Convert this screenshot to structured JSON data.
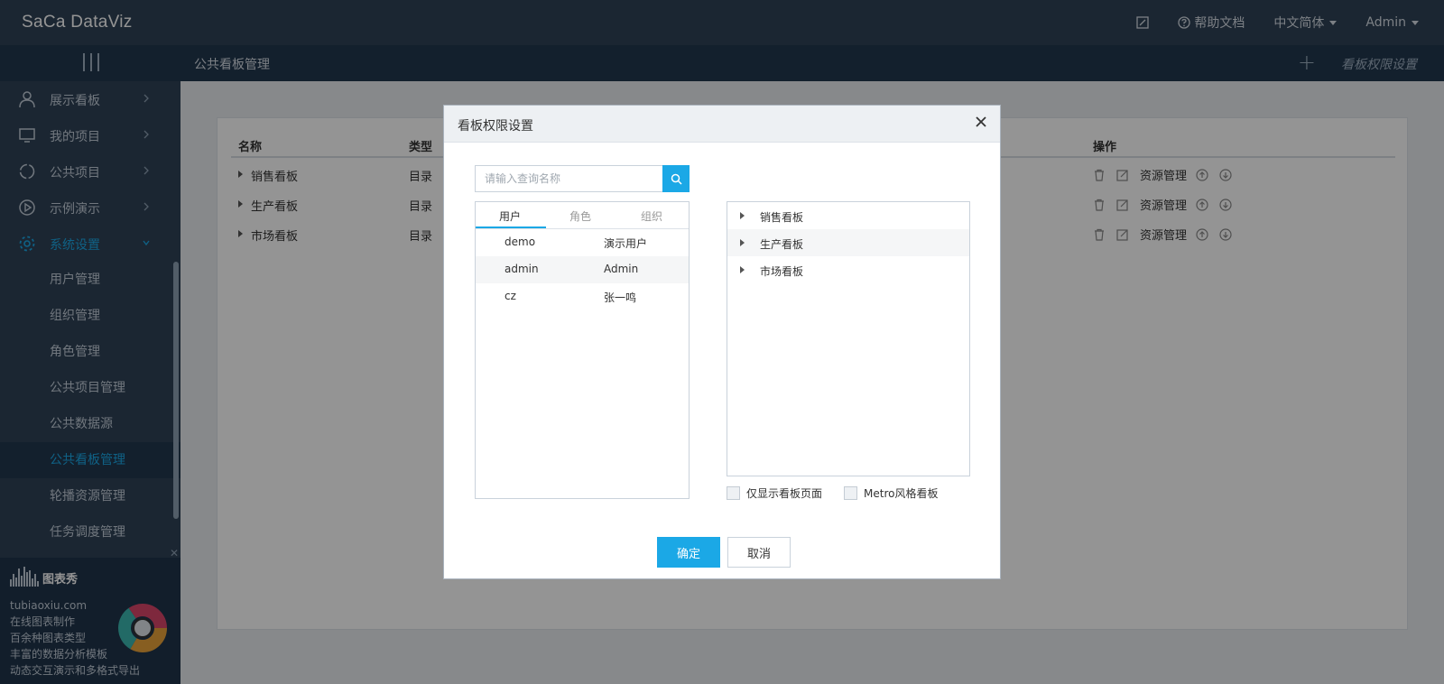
{
  "app": {
    "logo_text": "SaCa DataViz"
  },
  "topbar": {
    "help_label": "帮助文档",
    "language_label": "中文简体",
    "user_label": "Admin"
  },
  "subbar": {
    "title": "公共看板管理",
    "permission_link": "看板权限设置"
  },
  "sidebar": {
    "items": [
      {
        "label": "展示看板",
        "icon": "user-icon"
      },
      {
        "label": "我的项目",
        "icon": "monitor-icon"
      },
      {
        "label": "公共项目",
        "icon": "refresh-icon"
      },
      {
        "label": "示例演示",
        "icon": "play-icon"
      },
      {
        "label": "系统设置",
        "icon": "gear-icon"
      }
    ],
    "subitems": [
      "用户管理",
      "组织管理",
      "角色管理",
      "公共项目管理",
      "公共数据源",
      "公共看板管理",
      "轮播资源管理",
      "任务调度管理"
    ]
  },
  "ad": {
    "brand": "图表秀",
    "lines": [
      "tubiaoxiu.com",
      "在线图表制作",
      "百余种图表类型",
      "丰富的数据分析模板",
      "动态交互演示和多格式导出"
    ]
  },
  "table": {
    "headers": {
      "name": "名称",
      "type": "类型",
      "ops": "操作"
    },
    "op_link": "资源管理",
    "rows": [
      {
        "name": "销售看板",
        "type": "目录"
      },
      {
        "name": "生产看板",
        "type": "目录"
      },
      {
        "name": "市场看板",
        "type": "目录"
      }
    ]
  },
  "modal": {
    "title": "看板权限设置",
    "search_placeholder": "请输入查询名称",
    "tabs": [
      "用户",
      "角色",
      "组织"
    ],
    "users": [
      {
        "id": "demo",
        "name": "演示用户"
      },
      {
        "id": "admin",
        "name": "Admin"
      },
      {
        "id": "cz",
        "name": "张一鸣"
      }
    ],
    "tree": [
      "销售看板",
      "生产看板",
      "市场看板"
    ],
    "checkbox_only_pages": "仅显示看板页面",
    "checkbox_metro": "Metro风格看板",
    "ok_label": "确定",
    "cancel_label": "取消"
  },
  "colors": {
    "topbar": "#2f4257",
    "subbar": "#22384f",
    "accent": "#1ba8e6"
  }
}
